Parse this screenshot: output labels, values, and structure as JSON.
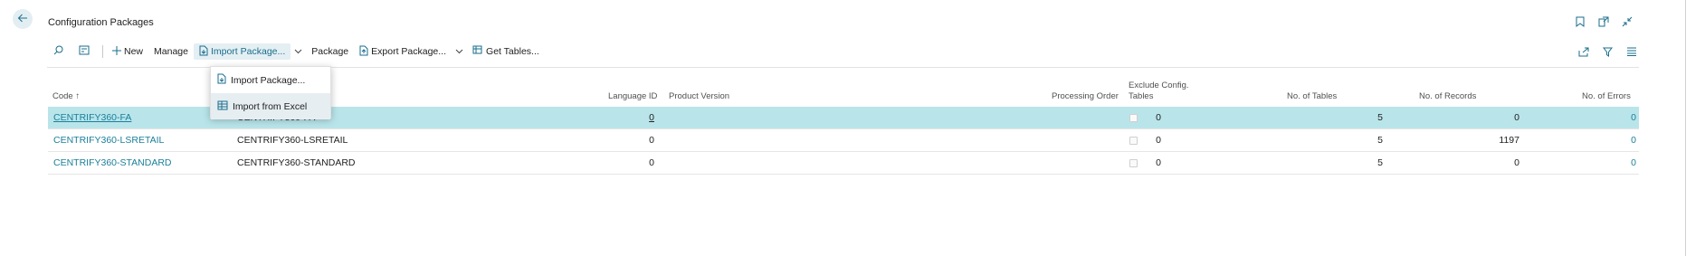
{
  "page": {
    "title": "Configuration Packages"
  },
  "toolbar": {
    "new_label": "New",
    "manage_label": "Manage",
    "import_package_label": "Import Package...",
    "package_label": "Package",
    "export_package_label": "Export Package...",
    "get_tables_label": "Get Tables..."
  },
  "dropdown": {
    "items": [
      {
        "label": "Import Package..."
      },
      {
        "label": "Import from Excel"
      }
    ]
  },
  "columns": {
    "code": "Code ↑",
    "language_id": "Language ID",
    "product_version": "Product Version",
    "processing_order": "Processing Order",
    "exclude_config_tables_line1": "Exclude Config.",
    "exclude_config_tables_line2": "Tables",
    "no_of_tables": "No. of Tables",
    "no_of_records": "No. of Records",
    "no_of_errors": "No. of Errors"
  },
  "rows": [
    {
      "code": "CENTRIFY360-FA",
      "name": "CENTRIFY360-FA",
      "language_id": "0",
      "product_version": "",
      "processing_order": "0",
      "exclude": false,
      "no_of_tables": "5",
      "no_of_records": "0",
      "no_of_errors": "0"
    },
    {
      "code": "CENTRIFY360-LSRETAIL",
      "name": "CENTRIFY360-LSRETAIL",
      "language_id": "0",
      "product_version": "",
      "processing_order": "0",
      "exclude": false,
      "no_of_tables": "5",
      "no_of_records": "1197",
      "no_of_errors": "0"
    },
    {
      "code": "CENTRIFY360-STANDARD",
      "name": "CENTRIFY360-STANDARD",
      "language_id": "0",
      "product_version": "",
      "processing_order": "0",
      "exclude": false,
      "no_of_tables": "5",
      "no_of_records": "0",
      "no_of_errors": "0"
    }
  ],
  "colors": {
    "accent": "#1a7f9a",
    "selected_row": "#b9e5ea",
    "menu_hover": "#e6eef2"
  }
}
